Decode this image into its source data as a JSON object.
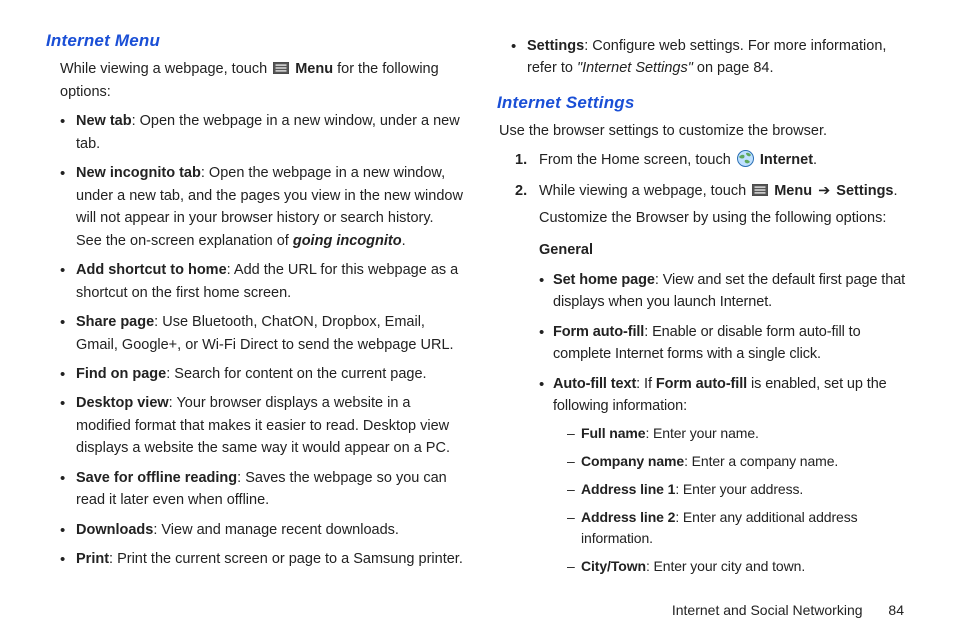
{
  "left": {
    "heading": "Internet Menu",
    "intro_before": "While viewing a webpage, touch ",
    "intro_menu": "Menu",
    "intro_after": " for the following options:",
    "items": [
      {
        "term": "New tab",
        "desc": ": Open the webpage in a new window, under a new tab."
      },
      {
        "term": "New incognito tab",
        "desc": ": Open the webpage in a new window, under a new tab, and the pages you view in the new window will not appear in your browser history or search history. See the on-screen explanation of ",
        "tail_bi": "going incognito",
        "tail_after": "."
      },
      {
        "term": "Add shortcut to home",
        "desc": ": Add the URL for this webpage as a shortcut on the first home screen."
      },
      {
        "term": "Share page",
        "desc": ": Use Bluetooth, ChatON, Dropbox, Email, Gmail, Google+, or Wi-Fi Direct to send the webpage URL."
      },
      {
        "term": "Find on page",
        "desc": ": Search for content on the current page."
      },
      {
        "term": "Desktop view",
        "desc": ": Your browser displays a website in a modified format that makes it easier to read. Desktop view displays a website the same way it would appear on a PC."
      },
      {
        "term": "Save for offline reading",
        "desc": ": Saves the webpage so you can read it later even when offline."
      },
      {
        "term": "Downloads",
        "desc": ": View and manage recent downloads."
      },
      {
        "term": "Print",
        "desc": ": Print the current screen or page to a Samsung printer."
      }
    ]
  },
  "right": {
    "top_item": {
      "term": "Settings",
      "desc": ": Configure web settings. For more information, refer to ",
      "ref": "\"Internet Settings\"",
      "ref_after": "  on page 84."
    },
    "heading": "Internet Settings",
    "intro": "Use the browser settings to customize the browser.",
    "step1_before": "From the Home screen, touch ",
    "step1_internet": "Internet",
    "step1_after": ".",
    "step2_before": "While viewing a webpage, touch ",
    "step2_menu": "Menu",
    "step2_arrow": "➔",
    "step2_settings": "Settings",
    "step2_after": ".",
    "step2_line2": "Customize the Browser by using the following options:",
    "general_label": "General",
    "general_items": [
      {
        "term": "Set home page",
        "desc": ": View and set the default first page that displays when you launch Internet."
      },
      {
        "term": "Form auto-fill",
        "desc": ": Enable or disable form auto-fill to complete Internet forms with a single click."
      },
      {
        "term": "Auto-fill text",
        "desc_before": ": If ",
        "desc_bold": "Form auto-fill",
        "desc_after": " is enabled, set up the following information:"
      }
    ],
    "autofill_fields": [
      {
        "term": "Full name",
        "desc": ": Enter your name."
      },
      {
        "term": "Company name",
        "desc": ": Enter a company name."
      },
      {
        "term": "Address line 1",
        "desc": ": Enter your address."
      },
      {
        "term": "Address line 2",
        "desc": ": Enter any additional address information."
      },
      {
        "term": "City/Town",
        "desc": ": Enter your city and town."
      }
    ]
  },
  "footer": {
    "label": "Internet and Social Networking",
    "page": "84"
  }
}
